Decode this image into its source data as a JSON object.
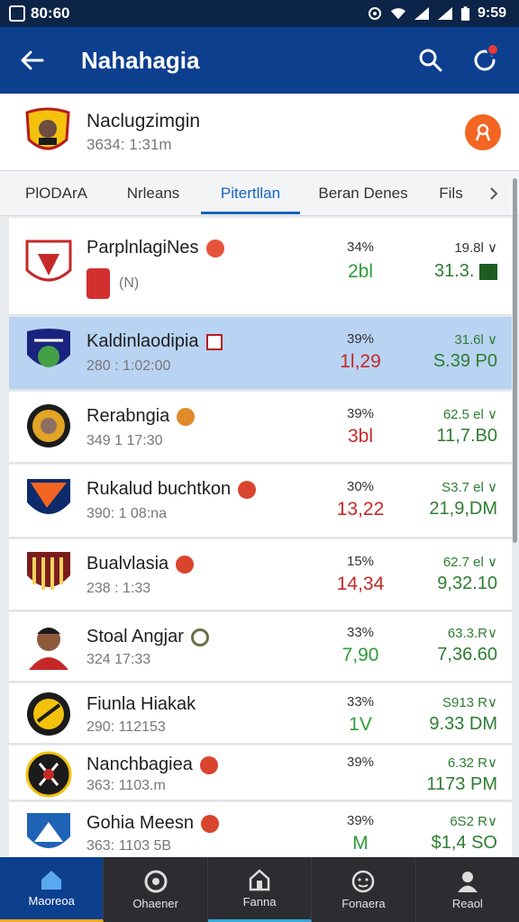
{
  "status_bar": {
    "time_left": "80:60",
    "time_right": "9:59"
  },
  "app_bar": {
    "title": "Nahahagia"
  },
  "team_header": {
    "name": "Naclugzimgin",
    "subtitle": "3634: 1:31m"
  },
  "tabs": [
    {
      "label": "PlODArA"
    },
    {
      "label": "Nrleans"
    },
    {
      "label": "Pitertllan",
      "active": true
    },
    {
      "label": "Beran Denes"
    },
    {
      "label": "Fils"
    }
  ],
  "matches": [
    {
      "name": "ParplnlagiNes",
      "sub": "(N)",
      "pct": "34%",
      "score": "2bl",
      "score_color": "green",
      "odds_top": "19.8l ∨",
      "odds_main": "31.3."
    },
    {
      "name": "Kaldinlaodipia",
      "sub": "280 : 1:02:00",
      "pct": "39%",
      "score": "1l,29",
      "score_color": "red",
      "odds_top": "31.6l ∨",
      "odds_main": "S.39 P0",
      "selected": true
    },
    {
      "name": "Rerabngia",
      "sub": "349 1 17:30",
      "pct": "39%",
      "score": "3bl",
      "score_color": "red",
      "odds_top": "62.5 el ∨",
      "odds_main": "11,7.B0"
    },
    {
      "name": "Rukalud buchtkon",
      "sub": "390: 1 08:na",
      "pct": "30%",
      "score": "13,22",
      "score_color": "red",
      "odds_top": "S3.7 el ∨",
      "odds_main": "21,9,DM"
    },
    {
      "name": "Bualvlasia",
      "sub": "238 : 1:33",
      "pct": "15%",
      "score": "14,34",
      "score_color": "red",
      "odds_top": "62.7 el ∨",
      "odds_main": "9,32.10"
    },
    {
      "name": "Stoal Angjar",
      "sub": "324 17:33",
      "pct": "33%",
      "score": "7,90",
      "score_color": "green",
      "odds_top": "63.3.R∨",
      "odds_main": "7,36.60"
    },
    {
      "name": "Fiunla Hiakak",
      "sub": "290: 112153",
      "pct": "33%",
      "score": "1V",
      "score_color": "green",
      "odds_top": "S913 R∨",
      "odds_main": "9.33 DM"
    },
    {
      "name": "Nanchbagiea",
      "sub": "363: 1103.m",
      "pct": "39%",
      "score": "",
      "score_color": "green",
      "odds_top": "6.32 R∨",
      "odds_main": "1173 PM"
    },
    {
      "name": "Gohia Meesn",
      "sub": "363: 1103 5B",
      "pct": "39%",
      "score": "M",
      "score_color": "green",
      "odds_top": "6S2 R∨",
      "odds_main": "$1,4 SO"
    }
  ],
  "bottom_nav": [
    {
      "label": "Maoreoa",
      "icon": "home-icon",
      "active": true
    },
    {
      "label": "Ohaener",
      "icon": "chat-icon"
    },
    {
      "label": "Fanna",
      "icon": "house-icon"
    },
    {
      "label": "Fonaera",
      "icon": "face-icon"
    },
    {
      "label": "Reaol",
      "icon": "person-icon"
    }
  ],
  "colors": {
    "app_bar": "#0d3f8f",
    "status_bar": "#0b2447",
    "accent": "#1565c0",
    "action": "#f26522"
  }
}
